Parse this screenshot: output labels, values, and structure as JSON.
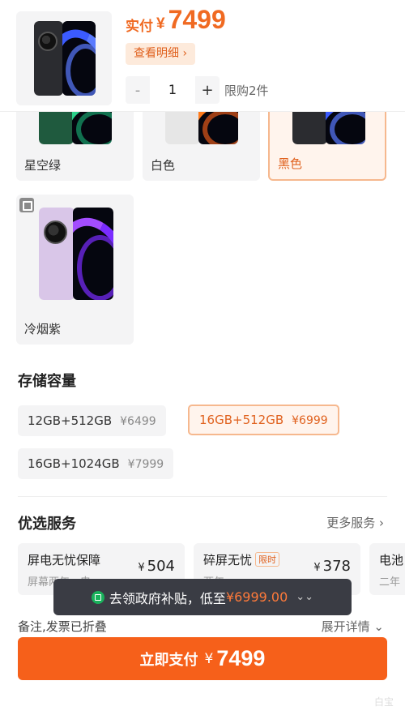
{
  "header": {
    "price_label": "实付",
    "currency": "¥",
    "price": "7499",
    "detail_button": "查看明细 ›",
    "quantity": "1",
    "minus": "-",
    "plus": "+",
    "limit": "限购2件"
  },
  "colors": [
    {
      "label": "星空绿",
      "selected": false
    },
    {
      "label": "白色",
      "selected": false
    },
    {
      "label": "黑色",
      "selected": true
    },
    {
      "label": "冷烟紫",
      "selected": false
    }
  ],
  "storage": {
    "title": "存储容量",
    "options": [
      {
        "label": "12GB+512GB",
        "price": "¥6499",
        "selected": false
      },
      {
        "label": "16GB+512GB",
        "price": "¥6999",
        "selected": true
      },
      {
        "label": "16GB+1024GB",
        "price": "¥7999",
        "selected": false
      }
    ]
  },
  "services": {
    "title": "优选服务",
    "more": "更多服务 ›",
    "items": [
      {
        "name": "屏电无忧保障",
        "tag": "",
        "sub": "屏幕两年，电...",
        "currency": "¥",
        "price": "504"
      },
      {
        "name": "碎屏无忧",
        "tag": "限时",
        "sub": "两年",
        "currency": "¥",
        "price": "378"
      },
      {
        "name": "电池",
        "tag": "",
        "sub": "二年",
        "currency": "",
        "price": ""
      }
    ]
  },
  "toast": {
    "text": "去领政府补贴，低至",
    "highlight": "¥6999.00",
    "icon": "double-chevron-down-icon"
  },
  "remark": {
    "text": "备注,发票已折叠",
    "expand": "展开详情 ⌄"
  },
  "pay": {
    "label": "立即支付",
    "currency": "¥",
    "price": "7499"
  },
  "watermark": "白宝",
  "accent_color": "#f6601a"
}
